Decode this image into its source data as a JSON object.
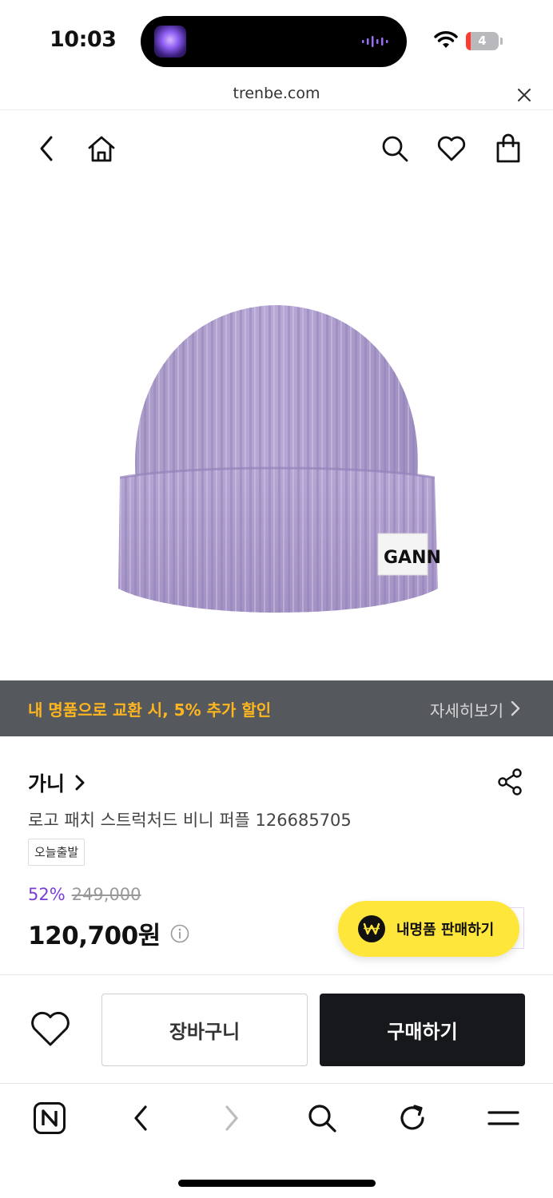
{
  "status_bar": {
    "time": "10:03",
    "battery_level": "4"
  },
  "url_bar": {
    "url": "trenbe.com"
  },
  "promo": {
    "text": "내 명품으로 교환 시, 5% 추가 할인",
    "more_label": "자세히보기"
  },
  "product": {
    "logo_text": "GANN",
    "brand": "가니",
    "name": "로고 패치 스트럭처드 비니 퍼플 126685705",
    "shipping_badge": "오늘출발",
    "discount": "52%",
    "original_price": "249,000",
    "final_price": "120,700원"
  },
  "fab": {
    "label": "내명품 판매하기"
  },
  "actions": {
    "cart_label": "장바구니",
    "buy_label": "구매하기"
  },
  "colors": {
    "accent_purple": "#7a3dd6",
    "promo_bg": "#55595e",
    "promo_text": "#ffb61e",
    "fab_yellow": "#ffe63b",
    "buy_bg": "#16181b"
  }
}
